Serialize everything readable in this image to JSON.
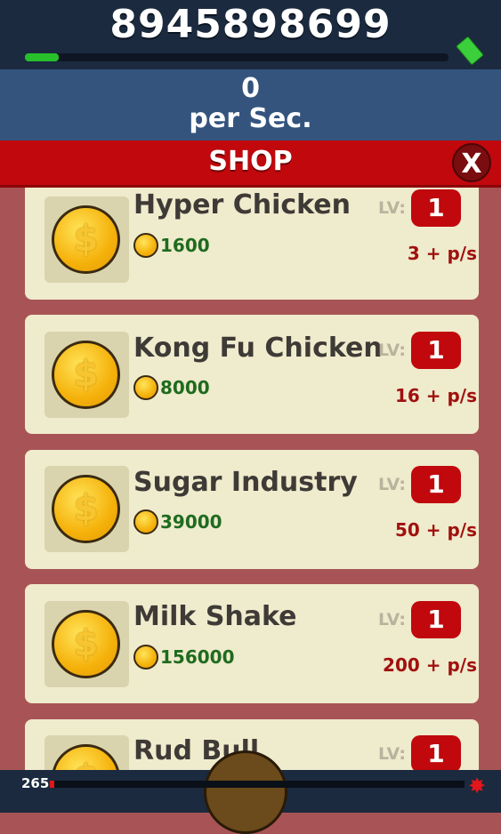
{
  "header": {
    "money": "8945898699",
    "money_progress_fraction": 0.08
  },
  "rate": {
    "value": "0",
    "label": "per Sec."
  },
  "shop": {
    "title": "SHOP",
    "close_label": "X",
    "items": [
      {
        "name": "Hyper Chicken",
        "price": "1600",
        "lv_label": "LV:",
        "level": "1",
        "rate": "3 + p/s",
        "coin_symbol": "$"
      },
      {
        "name": "Kong Fu Chicken",
        "price": "8000",
        "lv_label": "LV:",
        "level": "1",
        "rate": "16 + p/s",
        "coin_symbol": "$"
      },
      {
        "name": "Sugar Industry",
        "price": "39000",
        "lv_label": "LV:",
        "level": "1",
        "rate": "50 + p/s",
        "coin_symbol": "$"
      },
      {
        "name": "Milk Shake",
        "price": "156000",
        "lv_label": "LV:",
        "level": "1",
        "rate": "200 + p/s",
        "coin_symbol": "$"
      },
      {
        "name": "Rud Bull",
        "price": "",
        "lv_label": "LV:",
        "level": "1",
        "rate": "",
        "coin_symbol": "$"
      }
    ]
  },
  "footer": {
    "count": "265",
    "progress_fraction": 0.01
  },
  "colors": {
    "accent_red": "#c0080d",
    "header_dark": "#1b2a3e",
    "rate_blue": "#34547e",
    "card_bg": "#efebcd",
    "price_green": "#1f6b1f"
  },
  "icons": {
    "cash": "cash-icon",
    "coin": "coin-icon",
    "splat": "splat-icon",
    "close": "close-icon"
  }
}
